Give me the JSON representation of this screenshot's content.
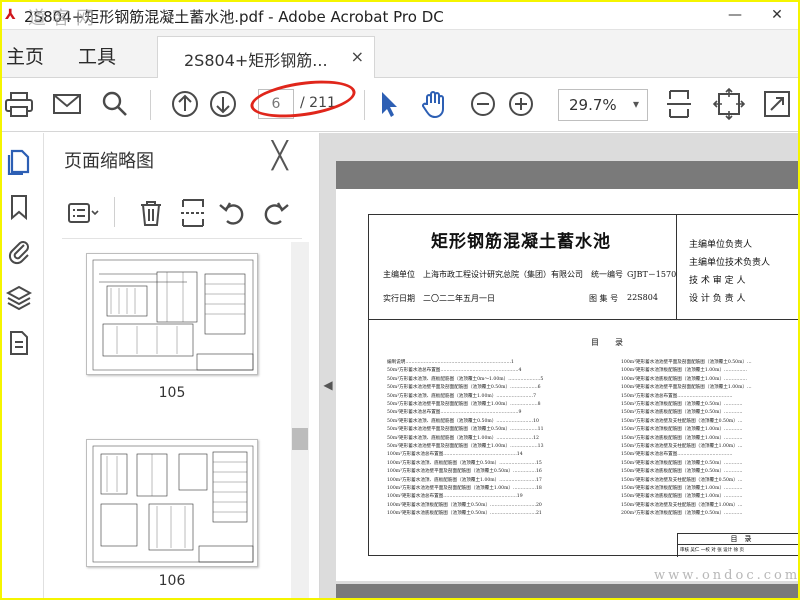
{
  "window": {
    "title": "2S804+矩形钢筋混凝土蓄水池.pdf - Adobe Acrobat Pro DC",
    "minimize": "—",
    "close": "✕"
  },
  "menu": {
    "home": "主页",
    "tools": "工具",
    "doc_tab_label": "2S804+矩形钢筋...",
    "doc_tab_close": "×"
  },
  "toolbar": {
    "page_current": "6",
    "page_total": "/ 211",
    "zoom": "29.7%",
    "zoom_caret": "▾"
  },
  "pane": {
    "title": "页面缩略图",
    "close": "╳",
    "thumbs": [
      {
        "page_label": "105"
      },
      {
        "page_label": "106"
      }
    ]
  },
  "document": {
    "title": "矩形钢筋混凝土蓄水池",
    "editor_label": "主编单位",
    "editor_value": "上海市政工程设计研究总院（集团）有限公司",
    "serial_label": "统一编号",
    "serial_value": "GJBT－1570",
    "date_label": "实行日期",
    "date_value": "二〇二二年五月一日",
    "atlas_label": "图 集 号",
    "atlas_value": "22S804",
    "responsibilities": [
      "主编单位负责人",
      "主编单位技术负责人",
      "技 术 审 定 人",
      "设 计 负 责 人"
    ],
    "toc_heading": "目　　录",
    "toc_left": [
      "编制说明……………………………………………………………1",
      "50m³方形蓄水池总布置图……………………………………………4",
      "50m³方形蓄水池顶、底板配筋图（池顶覆土0m～1.00m）…………………5",
      "50m³方形蓄水池池壁平面及剖面配筋图（池顶覆土0.50m）………………6",
      "50m³方形蓄水池顶、底板配筋图（池顶覆土1.00m）……………………7",
      "50m³方形蓄水池池壁平面及剖面配筋图（池顶覆土1.00m）………………8",
      "50m³矩形蓄水池总布置图……………………………………………9",
      "50m³矩形蓄水池顶、底板配筋图（池顶覆土0.50m）……………………10",
      "50m³矩形蓄水池池壁平面及剖面配筋图（池顶覆土0.50m）………………11",
      "50m³矩形蓄水池顶、底板配筋图（池顶覆土1.00m）……………………12",
      "50m³矩形蓄水池池壁平面及剖面配筋图（池顶覆土1.00m）………………13",
      "100m³方形蓄水池总布置图…………………………………………14",
      "100m³方形蓄水池顶、底板配筋图（池顶覆土0.50m）……………………15",
      "100m³方形蓄水池池壁平面及剖面配筋图（池顶覆土0.50m）……………16",
      "100m³方形蓄水池顶、底板配筋图（池顶覆土1.00m）……………………17",
      "100m³方形蓄水池池壁平面及剖面配筋图（池顶覆土1.00m）……………18",
      "100m³矩形蓄水池总布置图…………………………………………19",
      "100m³矩形蓄水池顶板配筋图（池顶覆土0.50m）…………………………20",
      "100m³矩形蓄水池底板配筋图（池顶覆土0.50m）…………………………21"
    ],
    "toc_right": [
      "100m³矩形蓄水池池壁平面及剖面配筋图（池顶覆土0.50m）…",
      "100m³矩形蓄水池顶板配筋图（池顶覆土1.00m）……………",
      "100m³矩形蓄水池底板配筋图（池顶覆土1.00m）……………",
      "100m³矩形蓄水池池壁平面及剖面配筋图（池顶覆土1.00m）…",
      "150m³方形蓄水池总布置图………………………………",
      "150m³方形蓄水池顶板配筋图（池顶覆土0.50m）…………",
      "150m³方形蓄水池底板配筋图（池顶覆土0.50m）…………",
      "150m³方形蓄水池池壁及支柱配筋图（池顶覆土0.50m）…",
      "150m³方形蓄水池顶板配筋图（池顶覆土1.00m）…………",
      "150m³方形蓄水池底板配筋图（池顶覆土1.00m）…………",
      "150m³方形蓄水池池壁及支柱配筋图（池顶覆土1.00m）…",
      "150m³矩形蓄水池总布置图………………………………",
      "150m³矩形蓄水池顶板配筋图（池顶覆土0.50m）…………",
      "150m³矩形蓄水池底板配筋图（池顶覆土0.50m）…………",
      "150m³矩形蓄水池池壁及支柱配筋图（池顶覆土0.50m）…",
      "150m³矩形蓄水池顶板配筋图（池顶覆土1.00m）…………",
      "150m³矩形蓄水池底板配筋图（池顶覆土1.00m）…………",
      "150m³矩形蓄水池池壁及支柱配筋图（池顶覆土1.00m）…",
      "200m³方形蓄水池顶板配筋图（池顶覆土0.50m）…………"
    ],
    "footer_heading": "目　录",
    "footer_row": "审核 吴仁 一校 对 张 设计 徐 页"
  },
  "watermarks": {
    "top_left": "道客网",
    "bottom_right": "www.ondoc.com"
  },
  "colors": {
    "frame": "#f5f500",
    "annotation_circle": "#e0261b",
    "icon_blue": "#2d5fb4",
    "icon_gray": "#4a4a4a"
  }
}
